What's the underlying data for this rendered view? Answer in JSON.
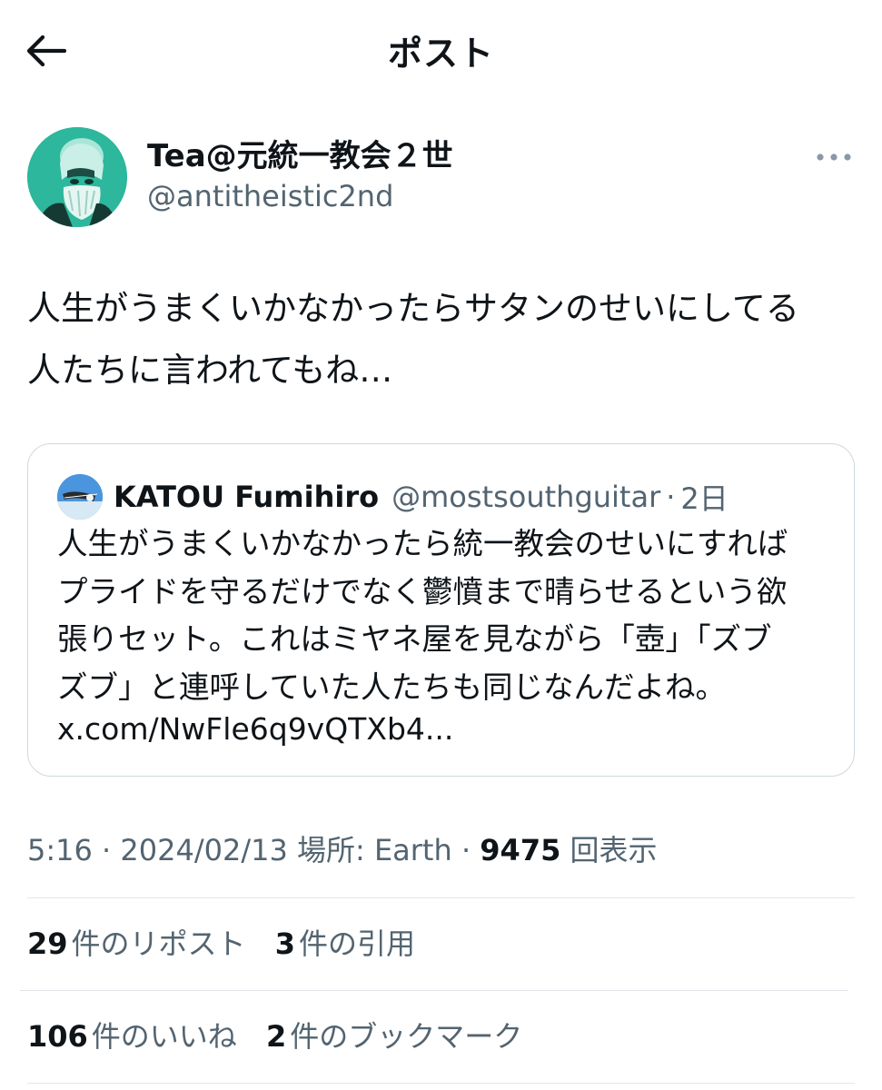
{
  "header": {
    "title": "ポスト",
    "back_icon": "arrow-left-icon"
  },
  "author": {
    "display_name": "Tea@元統一教会２世",
    "handle": "@antitheistic2nd",
    "more_icon": "more-horizontal-icon"
  },
  "tweet": {
    "text_line1": "人生がうまくいかなかったらサタンのせいにしてる",
    "text_line2": "人たちに言われてもね…"
  },
  "quote": {
    "name": "KATOU Fumihiro",
    "handle": "@mostsouthguitar",
    "separator": "·",
    "time": "2日",
    "line1": "人生がうまくいかなかったら統一教会のせいにすれば",
    "line2": "プライドを守るだけでなく鬱憤まで晴らせるという欲",
    "line3": "張りセット。これはミヤネ屋を見ながら「壺」「ズブ",
    "line4": "ズブ」と連呼していた人たちも同じなんだよね。",
    "link": "x.com/NwFle6q9vQTXb4..."
  },
  "meta": {
    "time": "5:16",
    "date": "2024/02/13",
    "location": "場所: Earth",
    "views_count": "9475",
    "views_label": "回表示"
  },
  "stats": {
    "reposts_count": "29",
    "reposts_label": "件のリポスト",
    "quotes_count": "3",
    "quotes_label": "件の引用",
    "likes_count": "106",
    "likes_label": "件のいいね",
    "bookmarks_count": "2",
    "bookmarks_label": "件のブックマーク"
  },
  "colors": {
    "text": "#0f1419",
    "secondary": "#536471",
    "border": "#cfd9de",
    "avatar_teal": "#2bb49a"
  }
}
